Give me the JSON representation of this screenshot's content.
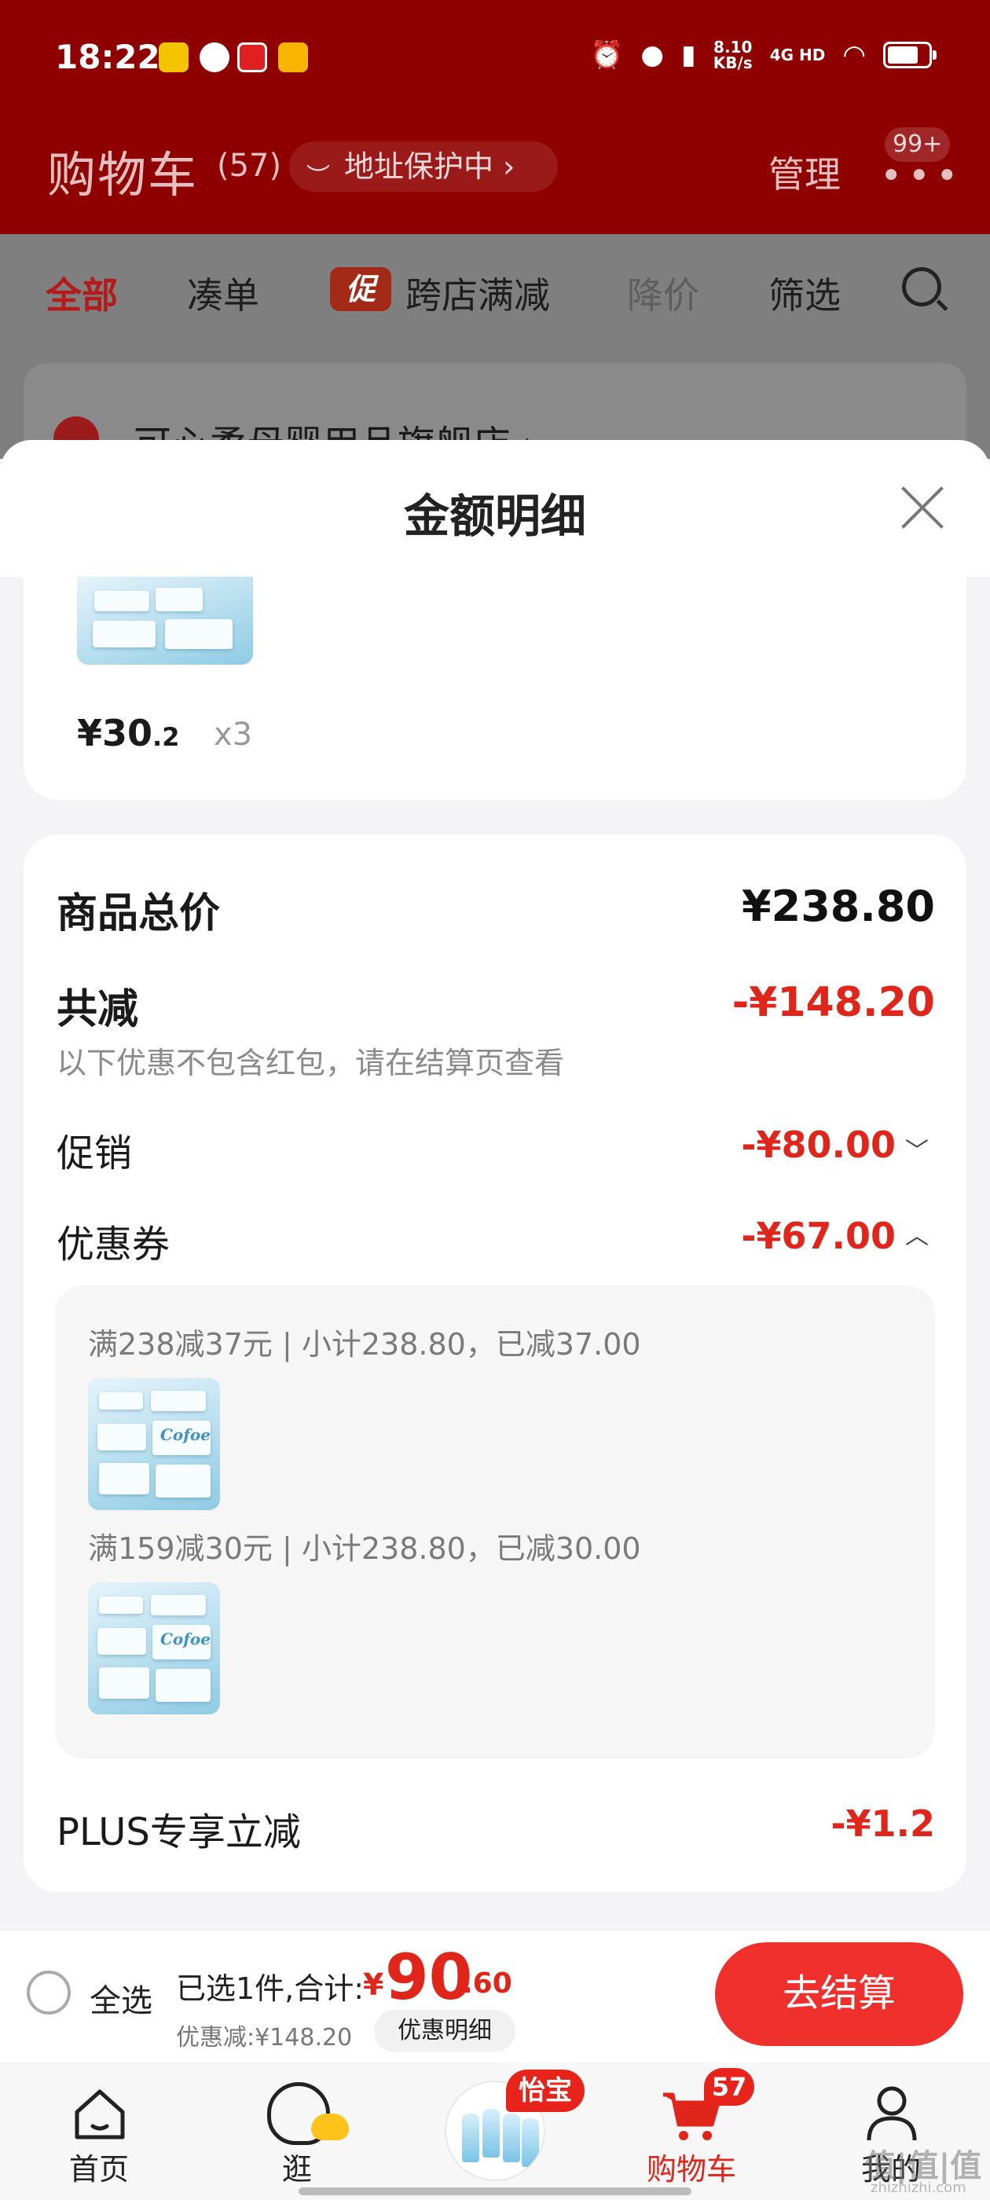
{
  "status_bar": {
    "time": "18:22",
    "net_speed_value": "8.10",
    "net_speed_unit": "KB/s",
    "network": "4G HD"
  },
  "header": {
    "title": "购物车",
    "count": "(57)",
    "address_pill": "地址保护中 ›",
    "manage": "管理",
    "messages_badge": "99+"
  },
  "tabs": [
    {
      "label": "全部"
    },
    {
      "label": "凑单"
    },
    {
      "label": "跨店满减",
      "badge": "促"
    },
    {
      "label": "降价"
    },
    {
      "label": "筛选"
    }
  ],
  "store_row": {
    "name": "可心柔母婴用品旗舰店 ›"
  },
  "sheet": {
    "title": "金额明细",
    "item": {
      "price_int": "¥30",
      "price_dec": ".2",
      "qty": "x3"
    },
    "rows": {
      "total_label": "商品总价",
      "total_value": "¥238.80",
      "reduce_label": "共减",
      "reduce_value": "-¥148.20",
      "reduce_note": "以下优惠不包含红包，请在结算页查看",
      "promo_label": "促销",
      "promo_value": "-¥80.00",
      "coupon_label": "优惠券",
      "coupon_value": "-¥67.00",
      "plus_label": "PLUS专享立减",
      "plus_value": "-¥1.2"
    },
    "coupons": [
      {
        "text": "满238减37元 | 小计238.80，已减37.00"
      },
      {
        "text": "满159减30元 | 小计238.80，已减30.00"
      }
    ]
  },
  "checkout": {
    "select_all": "全选",
    "selected_text": "已选1件,合计:",
    "total_yen": "¥",
    "total_int": "90",
    "total_dec": ".60",
    "discount_text": "优惠减:¥148.20",
    "discount_detail_button": "优惠明细",
    "pay_button": "去结算"
  },
  "bottom_nav": {
    "items": [
      {
        "label": "首页"
      },
      {
        "label": "逛"
      },
      {
        "label": "",
        "badge": "怡宝"
      },
      {
        "label": "购物车",
        "badge": "57"
      },
      {
        "label": "我的"
      }
    ]
  },
  "watermark": {
    "main": "值|值|值",
    "sub": "zhizhizhi.com"
  },
  "colors": {
    "header_red": "#8f0000",
    "accent_red": "#e0251b",
    "pay_button": "#f0302d"
  }
}
